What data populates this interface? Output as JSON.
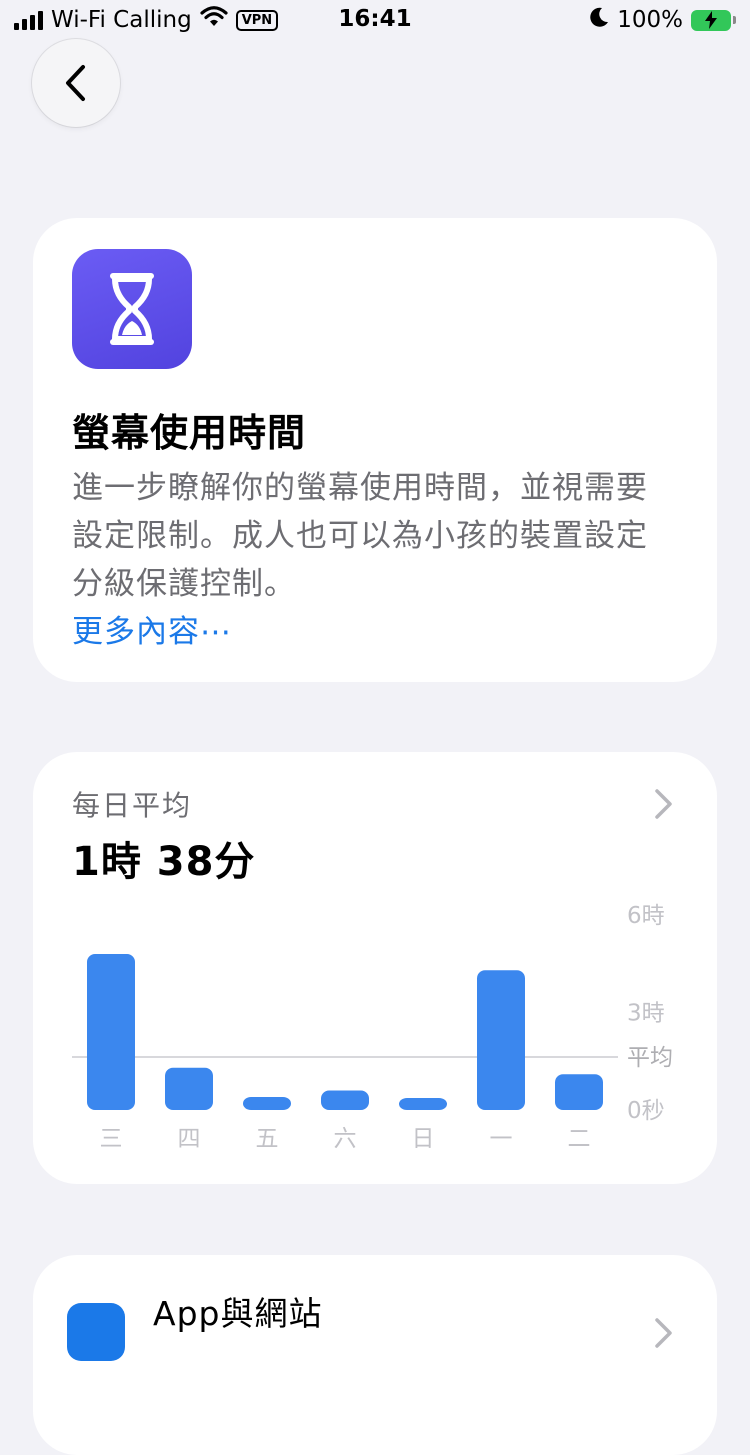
{
  "status_bar": {
    "carrier": "Wi-Fi Calling",
    "vpn": "VPN",
    "time": "16:41",
    "battery": "100%"
  },
  "intro_card": {
    "title": "螢幕使用時間",
    "description": "進一步瞭解你的螢幕使用時間，並視需要設定限制。成人也可以為小孩的裝置設定分級保護控制。",
    "more_link": "更多內容⋯"
  },
  "usage_card": {
    "label": "每日平均",
    "value": "1時 38分"
  },
  "chart_data": {
    "type": "bar",
    "categories": [
      "三",
      "四",
      "五",
      "六",
      "日",
      "一",
      "二"
    ],
    "values": [
      4.8,
      1.3,
      0.4,
      0.6,
      0.35,
      4.3,
      1.1
    ],
    "average": 1.63,
    "ylim": [
      0,
      6
    ],
    "yticks": [
      "0秒",
      "3時",
      "6時"
    ],
    "average_label": "平均",
    "bar_color": "#3B87EE"
  },
  "apps_card": {
    "title": "App與網站"
  }
}
